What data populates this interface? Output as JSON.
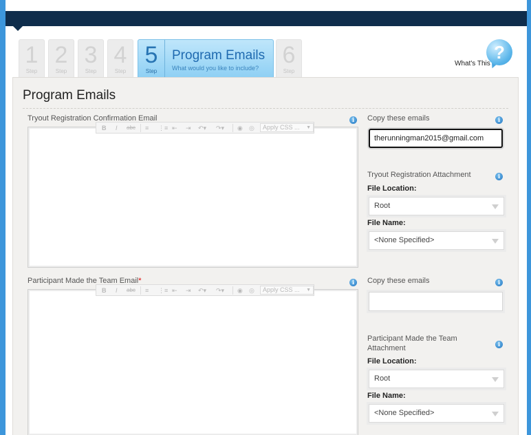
{
  "wizard": {
    "steps": [
      {
        "num": "1",
        "label": "Step"
      },
      {
        "num": "2",
        "label": "Step"
      },
      {
        "num": "3",
        "label": "Step"
      },
      {
        "num": "4",
        "label": "Step"
      },
      {
        "num": "5",
        "label": "Step",
        "title": "Program Emails",
        "subtitle": "What would you like to include?"
      },
      {
        "num": "6",
        "label": "Step"
      }
    ],
    "active_step": 5,
    "whats_this": "What's This",
    "help_icon_glyph": "?"
  },
  "page": {
    "title": "Program Emails"
  },
  "toolbar": {
    "bold": "B",
    "italic": "I",
    "strike": "abc",
    "apply_css": "Apply CSS ...",
    "icons": [
      "bold-icon",
      "italic-icon",
      "strikethrough-icon",
      "ordered-list-icon",
      "unordered-list-icon",
      "outdent-icon",
      "indent-icon",
      "undo-icon",
      "redo-icon",
      "link-icon",
      "unlink-icon"
    ]
  },
  "sections": [
    {
      "email_label": "Tryout Registration Confirmation Email",
      "email_required": false,
      "copy_label": "Copy these emails",
      "copy_value": "therunningman2015@gmail.com",
      "attachment_label": "Tryout Registration Attachment",
      "file_location_label": "File Location:",
      "file_location_value": "Root",
      "file_name_label": "File Name:",
      "file_name_value": "<None Specified>"
    },
    {
      "email_label": "Participant Made the Team Email",
      "email_required": true,
      "required_mark": "*",
      "copy_label": "Copy these emails",
      "copy_value": "",
      "attachment_label": "Participant Made the Team Attachment",
      "file_location_label": "File Location:",
      "file_location_value": "Root",
      "file_name_label": "File Name:",
      "file_name_value": "<None Specified>"
    }
  ],
  "info_glyph": "i",
  "colors": {
    "background": "#3d96db",
    "header_bar": "#0f2d4c",
    "active_step": "#8fd0f4",
    "required": "#dd0000"
  }
}
